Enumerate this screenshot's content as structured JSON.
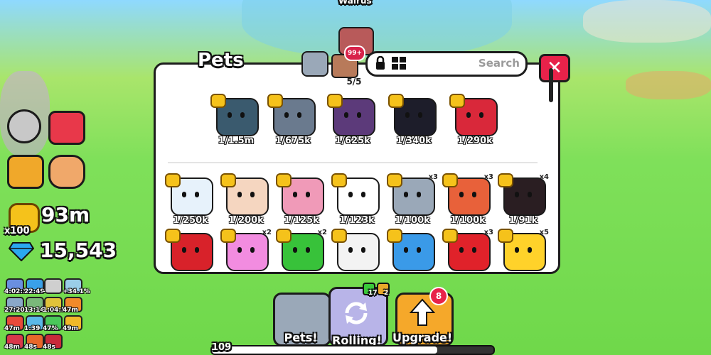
{
  "world": {
    "npc_name": "Walrus"
  },
  "panel": {
    "title": "Pets",
    "count": "5/5",
    "search_placeholder": "Search",
    "notification_badge": "99+",
    "close_symbol": "✕",
    "featured": [
      {
        "rarity": "1/1.5m",
        "color": "#3a5a6e"
      },
      {
        "rarity": "1/675k",
        "color": "#6a7a8e"
      },
      {
        "rarity": "1/625k",
        "color": "#5c3a7a"
      },
      {
        "rarity": "1/340k",
        "color": "#1d1d2a"
      },
      {
        "rarity": "1/290k",
        "color": "#d9283a"
      }
    ],
    "row1": [
      {
        "rarity": "1/250k",
        "color": "#e7f2fb",
        "mult": ""
      },
      {
        "rarity": "1/200k",
        "color": "#f5d6c0",
        "mult": ""
      },
      {
        "rarity": "1/125k",
        "color": "#f09ab8",
        "mult": ""
      },
      {
        "rarity": "1/123k",
        "color": "#ffffff",
        "mult": ""
      },
      {
        "rarity": "1/100k",
        "color": "#9aa8b8",
        "mult": "x3"
      },
      {
        "rarity": "1/100k",
        "color": "#e8613a",
        "mult": "x3"
      },
      {
        "rarity": "1/91k",
        "color": "#2a1e22",
        "mult": "x4"
      }
    ],
    "row2": [
      {
        "color": "#d8222a",
        "mult": ""
      },
      {
        "color": "#f28ce0",
        "mult": "x2"
      },
      {
        "color": "#38c23a",
        "mult": "x2"
      },
      {
        "color": "#f3f3f3",
        "mult": ""
      },
      {
        "color": "#3a9ae8",
        "mult": ""
      },
      {
        "color": "#e0222a",
        "mult": "x3"
      },
      {
        "color": "#ffd22a",
        "mult": "x5"
      }
    ]
  },
  "hud": {
    "coins": "93m",
    "coin_multiplier": "x100",
    "diamonds": "15,543",
    "buffs": [
      {
        "label": "4:02:38",
        "color": "#6a8fe0"
      },
      {
        "label": "22:49",
        "color": "#3aa0e8"
      },
      {
        "label": "-",
        "color": "#cfcfcf"
      },
      {
        "label": "+34.1%",
        "color": "#9acde8"
      },
      {
        "label": "27:20",
        "color": "#8aa8c8"
      },
      {
        "label": "13:14",
        "color": "#7ab87a"
      },
      {
        "label": "1:04:54",
        "color": "#e0c23a"
      },
      {
        "label": "47m",
        "color": "#f08a2a"
      },
      {
        "label": "47m",
        "color": "#e84a3a"
      },
      {
        "label": "1:39",
        "color": "#5ab8e8"
      },
      {
        "label": "47%",
        "color": "#4ac85a"
      },
      {
        "label": "49m",
        "color": "#f0b82a"
      },
      {
        "label": "48m",
        "color": "#d8384a"
      },
      {
        "label": "48s",
        "color": "#e8682a"
      },
      {
        "label": "48s",
        "color": "#c82a3a"
      }
    ]
  },
  "bottom": {
    "pets_label": "Pets!",
    "rolling_label": "Rolling!",
    "upgrade_label": "Upgrade!",
    "upgrade_badge": "8",
    "roll_count_a": "17",
    "roll_count_b": "2",
    "level": "109",
    "xp_progress": 0.8
  },
  "colors": {
    "close_red": "#e8224a",
    "coin_gold": "#f5c21b",
    "diamond_blue": "#2aa8f0"
  }
}
